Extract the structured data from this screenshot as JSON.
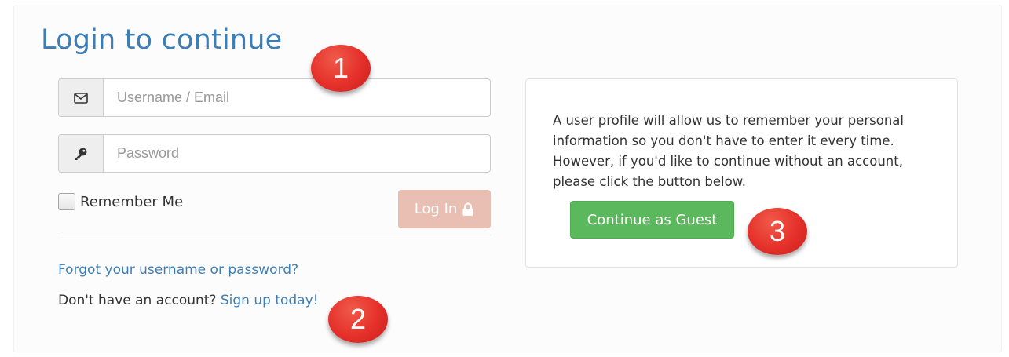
{
  "login": {
    "title": "Login to continue",
    "username": {
      "placeholder": "Username / Email",
      "value": ""
    },
    "password": {
      "placeholder": "Password",
      "value": ""
    },
    "remember_label": "Remember Me",
    "remember_checked": false,
    "login_button_label": "Log In",
    "forgot_link": "Forgot your username or password?",
    "signup_prompt": "Don't have an account?",
    "signup_link": "Sign up today!"
  },
  "guest": {
    "description": "A user profile will allow us to remember your personal information so you don't have to enter it every time. However, if you'd like to continue without an account, please click the button below.",
    "button_label": "Continue as Guest"
  },
  "annotations": {
    "badge_1": "1",
    "badge_2": "2",
    "badge_3": "3"
  },
  "icons": {
    "username": "envelope-icon",
    "password": "key-icon",
    "login_button": "lock-icon"
  },
  "colors": {
    "title": "#3c7eb5",
    "link": "#3c7eb5",
    "login_button": "#e9beb3",
    "guest_button": "#5cb85c",
    "badge": "#e5302a"
  }
}
